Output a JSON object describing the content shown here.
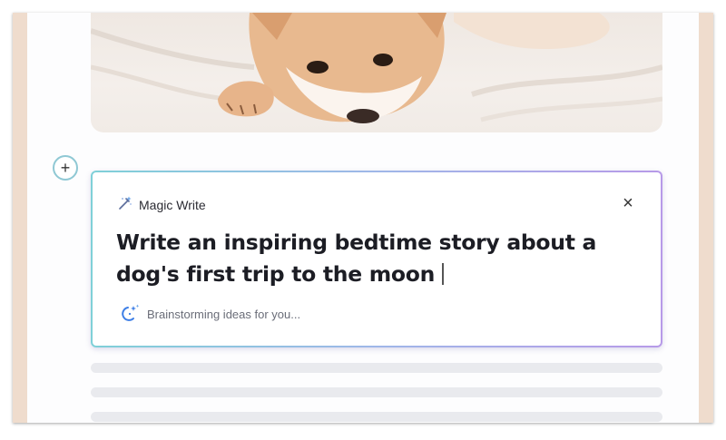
{
  "magic_write": {
    "title": "Magic Write",
    "close_label": "×",
    "prompt": "Write an inspiring bedtime story about a dog's first trip to the moon",
    "status": "Brainstorming ideas for you..."
  },
  "add_button": {
    "label": "+"
  },
  "icons": {
    "magic": "magic-wand-icon",
    "spinner": "sparkle-spinner-icon",
    "close": "close-icon",
    "add": "plus-icon"
  },
  "colors": {
    "frame": "#efdccd",
    "panel_gradient": [
      "#7fd0d8",
      "#9fb7e8",
      "#b79ae8"
    ],
    "spinner": "#3d7ee6"
  }
}
